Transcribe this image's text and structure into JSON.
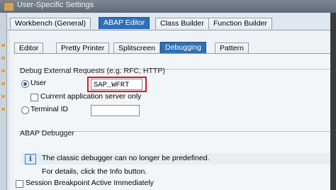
{
  "window": {
    "title": "User-Specific Settings"
  },
  "main_tabs": [
    {
      "label": "Workbench (General)"
    },
    {
      "label": "ABAP Editor"
    },
    {
      "label": "Class Builder"
    },
    {
      "label": "Function Builder"
    }
  ],
  "sub_tabs": [
    {
      "label": "Editor"
    },
    {
      "label": "Pretty Printer"
    },
    {
      "label": "Splitscreen"
    },
    {
      "label": "Debugging"
    },
    {
      "label": "Pattern"
    }
  ],
  "debug_external": {
    "title": "Debug External Requests (e.g. RFC, HTTP)",
    "user_label": "User",
    "user_value": "SAP_WFRT",
    "current_server_label": "Current application server only",
    "terminal_label": "Terminal ID"
  },
  "abap_debugger": {
    "title": "ABAP Debugger",
    "info_icon": "i",
    "message_line1": "The classic debugger can no longer be predefined.",
    "message_line2": "For details, click the Info button."
  },
  "session_breakpoint_label": "Session Breakpoint Active Immediately",
  "colors": {
    "active_tab": "#2f6fb6",
    "highlight": "#d21d1d",
    "panel_bg": "#eef2f6"
  }
}
